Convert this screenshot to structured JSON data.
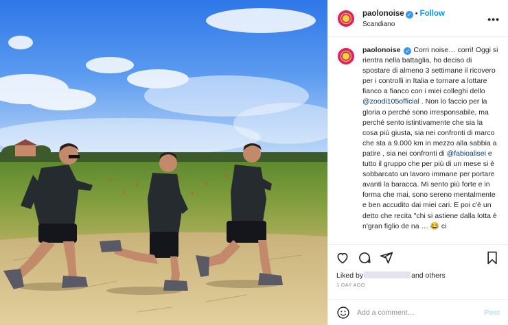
{
  "post": {
    "username": "paolonoise",
    "follow_label": "Follow",
    "dot": "•",
    "location": "Scandiano",
    "more_label": "•••",
    "verified_glyph": "✓"
  },
  "caption": {
    "username": "paolonoise",
    "part1": "Corri noise… corri! Oggi si rientra nella battaglia, ho deciso di spostare di almeno 3 settimane il ricovero per i controlli in Italia e tornare a lottare fianco a fianco con i miei colleghi dello ",
    "mention1": "@zoodi105official",
    "part2": " . Non lo faccio per la gloria o perché sono irresponsabile, ma perché sento istintivamente che sia la cosa più giusta, sia nei confronti di marco che sta a 9.000 km in mezzo alla sabbia a patire , sia nei confronti di ",
    "mention2": "@fabioalisei",
    "part3": " e tutto il gruppo che per più di un mese si è sobbarcato un lavoro immane per portare avanti la baracca. Mi sento più forte e in forma che mai, sono sereno mentalmente e ben accudito dai miei cari. E poi c'è un detto che recita \"chi si astiene dalla lotta è n'gran figlio de na … 😂 ci"
  },
  "icons": {
    "like": "heart-icon",
    "comment": "comment-icon",
    "share": "share-icon",
    "save": "bookmark-icon",
    "emoji": "emoji-icon"
  },
  "likes": {
    "prefix": "Liked by",
    "suffix": "and others"
  },
  "timestamp": "1 DAY AGO",
  "comment": {
    "placeholder": "Add a comment…",
    "post_label": "Post"
  },
  "colors": {
    "accent": "#0095f6",
    "verified": "#3897f0",
    "mention": "#00376b"
  }
}
